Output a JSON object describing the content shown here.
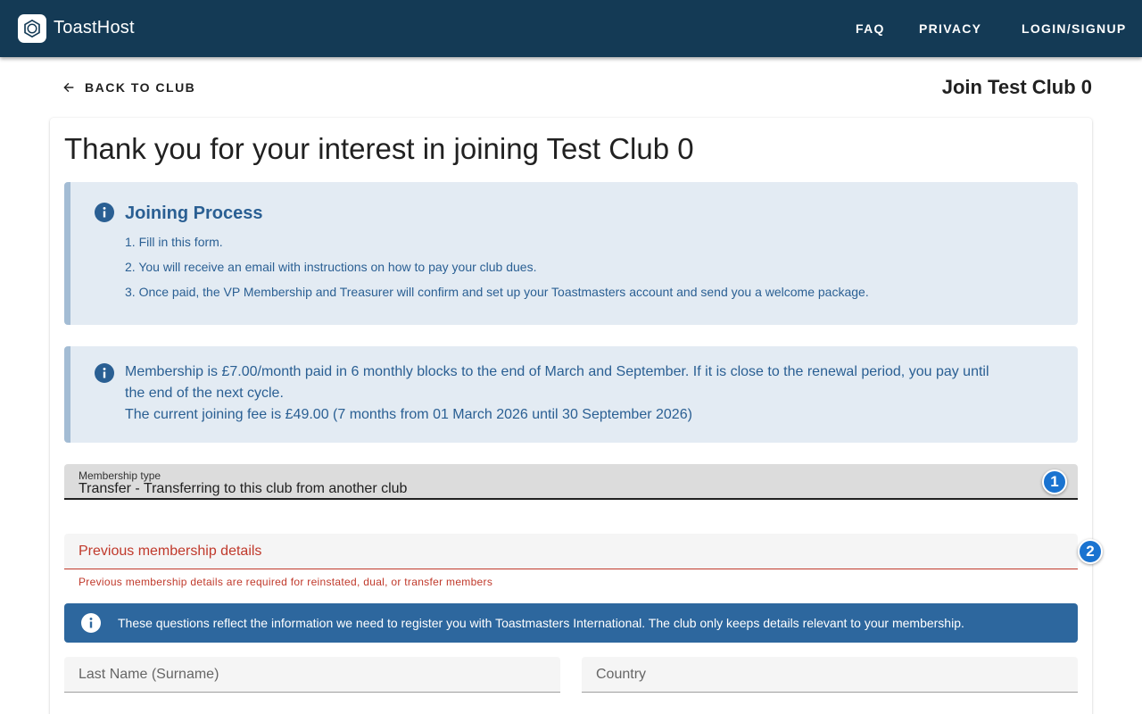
{
  "header": {
    "brand": "ToastHost",
    "nav": {
      "faq": "FAQ",
      "privacy": "PRIVACY",
      "login": "LOGIN/SIGNUP"
    }
  },
  "toolbar": {
    "back_label": "BACK TO CLUB",
    "page_heading": "Join Test Club 0"
  },
  "main": {
    "title": "Thank you for your interest in joining Test Club 0",
    "joining_process": {
      "title": "Joining Process",
      "steps": [
        "1. Fill in this form.",
        "2. You will receive an email with instructions on how to pay your club dues.",
        "3. Once paid, the VP Membership and Treasurer will confirm and set up your Toastmasters account and send you a welcome package."
      ]
    },
    "membership_info": {
      "line1": "Membership is £7.00/month paid in 6 monthly blocks to the end of March and September. If it is close to the renewal period, you pay until",
      "line2": "the end of the next cycle.",
      "line3": "The current joining fee is £49.00 (7 months from 01 March 2026 until 30 September 2026)"
    },
    "form": {
      "membership_type": {
        "label": "Membership type",
        "value": "Transfer - Transferring to this club from another club"
      },
      "previous_membership": {
        "placeholder": "Previous membership details",
        "error": "Previous membership details are required for reinstated, dual, or transfer members"
      },
      "info_banner": "These questions reflect the information we need to register you with Toastmasters International. The club only keeps details relevant to your membership.",
      "last_name": {
        "placeholder": "Last Name (Surname)"
      },
      "country": {
        "placeholder": "Country"
      }
    },
    "badges": [
      "1",
      "2"
    ]
  },
  "icons": {
    "logo": "logo-icon",
    "back": "arrow-left-icon",
    "info": "info-icon"
  },
  "colors": {
    "appbar": "#143a55",
    "alert_bg": "#e3ebf3",
    "alert_text": "#2a5f93",
    "banner_bg": "#2d679e",
    "error": "#c0392b",
    "badge": "#1a73d0"
  }
}
